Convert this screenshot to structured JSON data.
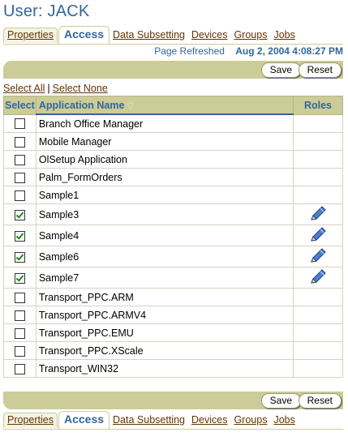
{
  "page": {
    "title": "User: JACK"
  },
  "tabs": [
    {
      "label": "Properties",
      "active": false
    },
    {
      "label": "Access",
      "active": true
    },
    {
      "label": "Data Subsetting",
      "active": false
    },
    {
      "label": "Devices",
      "active": false
    },
    {
      "label": "Groups",
      "active": false
    },
    {
      "label": "Jobs",
      "active": false
    }
  ],
  "refresh": {
    "label": "Page Refreshed",
    "date": "Aug 2, 2004 4:08:27 PM"
  },
  "buttons": {
    "save": "Save",
    "reset": "Reset"
  },
  "selection": {
    "select_all": "Select All",
    "select_none": "Select None",
    "separator": "|"
  },
  "table": {
    "headers": {
      "select": "Select",
      "app": "Application Name",
      "roles": "Roles"
    },
    "rows": [
      {
        "name": "Branch Office Manager",
        "checked": false,
        "has_role": false
      },
      {
        "name": "Mobile Manager",
        "checked": false,
        "has_role": false
      },
      {
        "name": "OlSetup Application",
        "checked": false,
        "has_role": false
      },
      {
        "name": "Palm_FormOrders",
        "checked": false,
        "has_role": false
      },
      {
        "name": "Sample1",
        "checked": false,
        "has_role": false
      },
      {
        "name": "Sample3",
        "checked": true,
        "has_role": true
      },
      {
        "name": "Sample4",
        "checked": true,
        "has_role": true
      },
      {
        "name": "Sample6",
        "checked": true,
        "has_role": true
      },
      {
        "name": "Sample7",
        "checked": true,
        "has_role": true
      },
      {
        "name": "Transport_PPC.ARM",
        "checked": false,
        "has_role": false
      },
      {
        "name": "Transport_PPC.ARMV4",
        "checked": false,
        "has_role": false
      },
      {
        "name": "Transport_PPC.EMU",
        "checked": false,
        "has_role": false
      },
      {
        "name": "Transport_PPC.XScale",
        "checked": false,
        "has_role": false
      },
      {
        "name": "Transport_WIN32",
        "checked": false,
        "has_role": false
      }
    ]
  },
  "icons": {
    "role_edit": "pencil-icon",
    "sort": "sort-ascending-icon"
  },
  "colors": {
    "accent": "#336699",
    "link": "#663300",
    "bar": "#cccc99",
    "check": "#1a8a1a"
  }
}
